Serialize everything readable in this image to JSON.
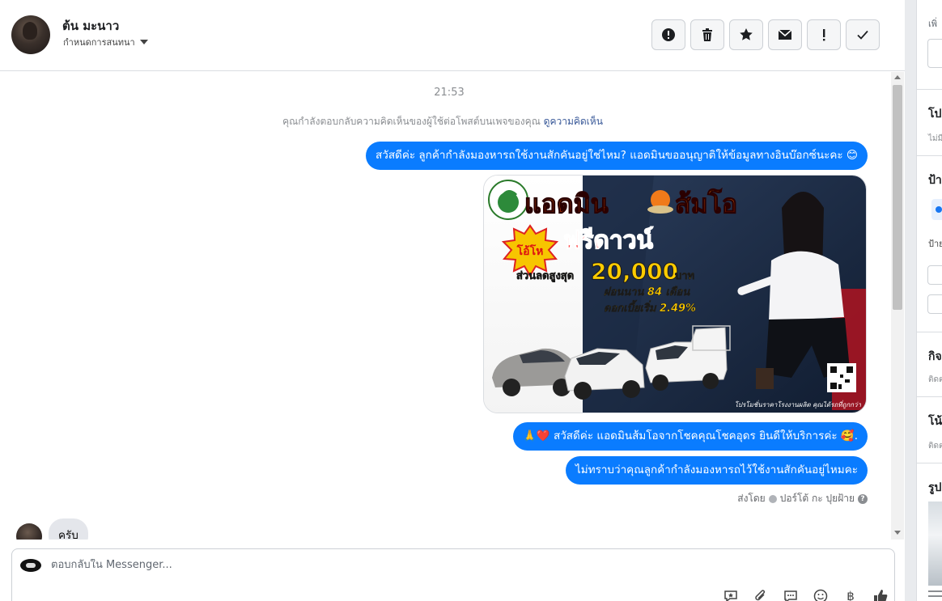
{
  "header": {
    "contact_name": "ต้น มะนาว",
    "assign_label": "กำหนดการสนทนา",
    "toolbar": [
      {
        "name": "mark-spam-button",
        "icon": "alert-circle-icon"
      },
      {
        "name": "delete-button",
        "icon": "trash-icon"
      },
      {
        "name": "star-button",
        "icon": "star-icon"
      },
      {
        "name": "mark-unread-button",
        "icon": "envelope-icon"
      },
      {
        "name": "follow-up-button",
        "icon": "exclamation-icon"
      },
      {
        "name": "mark-done-button",
        "icon": "check-icon"
      }
    ]
  },
  "conversation": {
    "time": "21:53",
    "notice_text": "คุณกำลังตอบกลับความคิดเห็นของผู้ใช้ต่อโพสต์บนเพจของคุณ",
    "notice_link": "ดูความคิดเห็น",
    "outgoing": [
      {
        "text": "สวัสดีค่ะ ลูกค้ากำลังมองหารถใช้งานสักคันอยู่ใช่ไหม? แอดมินขออนุญาติให้ข้อมูลทางอินบ๊อกซ์นะคะ 😊"
      },
      {
        "text": "🙏❤️ สวัสดีค่ะ แอดมินส้มโอจากโชคคุณโชคอุดร ยินดีให้บริการค่ะ 🥰."
      },
      {
        "text": "ไม่ทราบว่าคุณลูกค้ากำลังมองหารถไว้ใช้งานสักคันอยู่ไหมคะ"
      }
    ],
    "promo_image": {
      "headline_left": "แอดมิน",
      "headline_right": "ส้มโอ",
      "badge": "โอ้โห",
      "free_down": "ฟรีดาวน์",
      "discount_label": "ส่วนลดสูงสุด",
      "discount_amount": "20,000",
      "discount_unit": "บาท",
      "installment": "ผ่อนนาน 84 เดือน",
      "interest": "ดอกเบี้ยเริ่ม 2.49%",
      "footer": "โปรโมชั่นราคาโรงงานผลิต คุณได้รถที่ถูกกว่า"
    },
    "sent_by_label": "ส่งโดย",
    "sent_by_name": "ปอร์โต้ กะ ปุยฝ้าย",
    "incoming": [
      {
        "text": "ครับ"
      }
    ]
  },
  "composer": {
    "placeholder": "ตอบกลับใน Messenger...",
    "icons": [
      "saved-reply-icon",
      "attachment-icon",
      "chat-bubble-icon",
      "emoji-icon",
      "baht-icon",
      "like-icon"
    ]
  },
  "rail": {
    "sections": [
      "เพิ่",
      "โป",
      "ไม่มี",
      "ป้า",
      "ป้าย",
      "กิจ",
      "ติดต",
      "โน้",
      "ติดต",
      "รูป"
    ]
  },
  "colors": {
    "outgoing_bubble": "#0a7cff",
    "incoming_bubble": "#e4e6eb",
    "link": "#385898"
  }
}
